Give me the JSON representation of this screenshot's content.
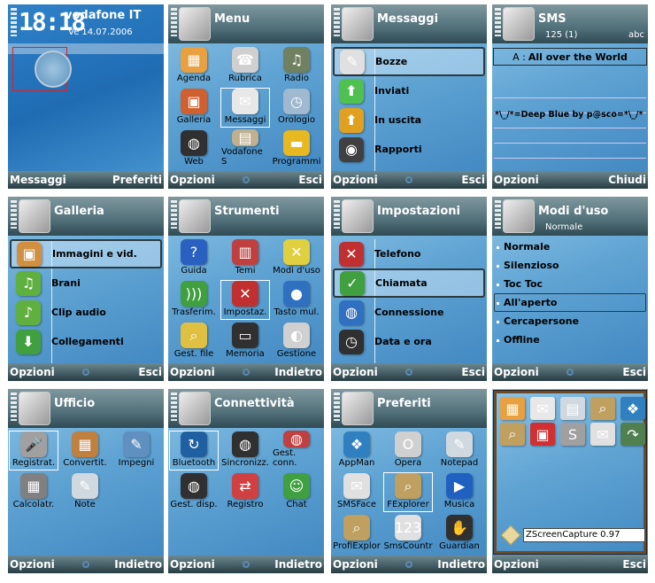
{
  "colors": {
    "highlight_border": "#2c3a40",
    "clock_frame": "#e02020",
    "bg_blue": "#5fa3d3"
  },
  "panels": [
    {
      "type": "home",
      "time": "18:18",
      "operator": "vodafone IT",
      "date": "Ve 14.07.2006",
      "soft_left": "Messaggi",
      "soft_right": "Preferiti"
    },
    {
      "type": "grid",
      "title": "Menu",
      "app_icon": "menu-icon",
      "selected": 4,
      "soft_left": "Opzioni",
      "soft_right": "Esci",
      "items": [
        {
          "label": "Agenda",
          "icon": "calendar",
          "color": "#e8a040",
          "glyph": "▦"
        },
        {
          "label": "Rubrica",
          "icon": "contacts",
          "color": "#d0d0d0",
          "glyph": "☎"
        },
        {
          "label": "Radio",
          "icon": "radio",
          "color": "#708060",
          "glyph": "♫"
        },
        {
          "label": "Galleria",
          "icon": "gallery",
          "color": "#d06030",
          "glyph": "▣"
        },
        {
          "label": "Messaggi",
          "icon": "envelope",
          "color": "#e8e8e8",
          "glyph": "✉"
        },
        {
          "label": "Orologio",
          "icon": "clock",
          "color": "#a0b8d0",
          "glyph": "◷"
        },
        {
          "label": "Web",
          "icon": "globe",
          "color": "#303030",
          "glyph": "◍"
        },
        {
          "label": "Vodafone S",
          "icon": "vodafone-services",
          "color": "#c0b090",
          "glyph": "▤"
        },
        {
          "label": "Programmi",
          "icon": "folder",
          "color": "#e8b820",
          "glyph": "▬"
        }
      ]
    },
    {
      "type": "list",
      "title": "Messaggi",
      "app_icon": "envelope-icon",
      "selected": 0,
      "soft_left": "Opzioni",
      "soft_right": "Esci",
      "items": [
        {
          "label": "Bozze",
          "icon": "drafts",
          "color": "#e0e0e0",
          "glyph": "✎"
        },
        {
          "label": "Inviati",
          "icon": "sent",
          "color": "#50c050",
          "glyph": "⬆"
        },
        {
          "label": "In uscita",
          "icon": "outbox",
          "color": "#e0a020",
          "glyph": "⬆"
        },
        {
          "label": "Rapporti",
          "icon": "reports",
          "color": "#404040",
          "glyph": "◉"
        }
      ]
    },
    {
      "type": "sms",
      "title": "SMS",
      "app_icon": "envelope-icon",
      "counter": "125 (1)",
      "mode": "abc",
      "to_label": "A :",
      "to_value": "All over the World",
      "body": "*\\_/*=Deep Blue by p@sco=*\\_/*",
      "soft_left": "Opzioni",
      "soft_right": "Chiudi"
    },
    {
      "type": "list",
      "title": "Galleria",
      "app_icon": "gallery-icon",
      "selected": 0,
      "soft_left": "Opzioni",
      "soft_right": "Esci",
      "items": [
        {
          "label": "Immagini e vid.",
          "icon": "images",
          "color": "#d09040",
          "glyph": "▣"
        },
        {
          "label": "Brani",
          "icon": "music",
          "color": "#60b040",
          "glyph": "♫"
        },
        {
          "label": "Clip audio",
          "icon": "audio-clip",
          "color": "#60b040",
          "glyph": "♪"
        },
        {
          "label": "Collegamenti",
          "icon": "links",
          "color": "#40a040",
          "glyph": "⬇"
        }
      ]
    },
    {
      "type": "grid",
      "title": "Strumenti",
      "app_icon": "menu-icon",
      "selected": 4,
      "soft_left": "Opzioni",
      "soft_right": "Indietro",
      "items": [
        {
          "label": "Guida",
          "icon": "help",
          "color": "#2a60c0",
          "glyph": "?"
        },
        {
          "label": "Temi",
          "icon": "themes",
          "color": "#c04040",
          "glyph": "▥"
        },
        {
          "label": "Modi d'uso",
          "icon": "profiles",
          "color": "#e0d040",
          "glyph": "✕"
        },
        {
          "label": "Trasferim.",
          "icon": "transfer",
          "color": "#40a040",
          "glyph": ")))"
        },
        {
          "label": "Impostaz.",
          "icon": "settings",
          "color": "#c03030",
          "glyph": "✕"
        },
        {
          "label": "Tasto mul.",
          "icon": "multimedia-key",
          "color": "#3070c0",
          "glyph": "●"
        },
        {
          "label": "Gest. file",
          "icon": "file-manager",
          "color": "#e0c040",
          "glyph": "⌕"
        },
        {
          "label": "Memoria",
          "icon": "memory",
          "color": "#303030",
          "glyph": "▭"
        },
        {
          "label": "Gestione",
          "icon": "app-manager",
          "color": "#d0d0d0",
          "glyph": "◐"
        }
      ]
    },
    {
      "type": "list",
      "title": "Impostazioni",
      "app_icon": "settings-icon",
      "selected": 1,
      "soft_left": "Opzioni",
      "soft_right": "Esci",
      "items": [
        {
          "label": "Telefono",
          "icon": "phone-settings",
          "color": "#c03030",
          "glyph": "✕"
        },
        {
          "label": "Chiamata",
          "icon": "call-settings",
          "color": "#40a040",
          "glyph": "✓"
        },
        {
          "label": "Connessione",
          "icon": "connection-settings",
          "color": "#3070c0",
          "glyph": "◍"
        },
        {
          "label": "Data e ora",
          "icon": "date-time",
          "color": "#303030",
          "glyph": "◷"
        }
      ]
    },
    {
      "type": "plain",
      "title": "Modi d'uso",
      "subtitle": "Normale",
      "app_icon": "profiles-icon",
      "selected": 3,
      "soft_left": "Opzioni",
      "soft_right": "Esci",
      "items": [
        "Normale",
        "Silenzioso",
        "Toc Toc",
        "All'aperto",
        "Cercapersone",
        "Offline"
      ]
    },
    {
      "type": "grid",
      "title": "Ufficio",
      "app_icon": "menu-icon",
      "selected": 0,
      "soft_left": "Opzioni",
      "soft_right": "Indietro",
      "items": [
        {
          "label": "Registrat.",
          "icon": "recorder",
          "color": "#a0a0a0",
          "glyph": "🎤"
        },
        {
          "label": "Convertit.",
          "icon": "converter",
          "color": "#c08040",
          "glyph": "▦"
        },
        {
          "label": "Impegni",
          "icon": "tasks",
          "color": "#6090c0",
          "glyph": "✎"
        },
        {
          "label": "Calcolatr.",
          "icon": "calculator",
          "color": "#808080",
          "glyph": "▦"
        },
        {
          "label": "Note",
          "icon": "notes",
          "color": "#d0d8e0",
          "glyph": "✎"
        }
      ]
    },
    {
      "type": "grid",
      "title": "Connettività",
      "app_icon": "menu-icon",
      "selected": 0,
      "soft_left": "Opzioni",
      "soft_right": "Indietro",
      "items": [
        {
          "label": "Bluetooth",
          "icon": "bluetooth",
          "color": "#2060a0",
          "glyph": "↻"
        },
        {
          "label": "Sincronizz.",
          "icon": "sync",
          "color": "#303030",
          "glyph": "◍"
        },
        {
          "label": "Gest. conn.",
          "icon": "connection-manager",
          "color": "#c04040",
          "glyph": "◍"
        },
        {
          "label": "Gest. disp.",
          "icon": "device-manager",
          "color": "#303030",
          "glyph": "◍"
        },
        {
          "label": "Registro",
          "icon": "log",
          "color": "#d04040",
          "glyph": "⇄"
        },
        {
          "label": "Chat",
          "icon": "chat",
          "color": "#40a040",
          "glyph": "☺"
        }
      ]
    },
    {
      "type": "grid",
      "title": "Preferiti",
      "app_icon": "menu-icon",
      "selected": 4,
      "soft_left": "Opzioni",
      "soft_right": "Indietro",
      "items": [
        {
          "label": "AppMan",
          "icon": "appman",
          "color": "#3080c0",
          "glyph": "❖"
        },
        {
          "label": "Opera",
          "icon": "opera",
          "color": "#d0d0d0",
          "glyph": "O"
        },
        {
          "label": "Notepad",
          "icon": "notepad",
          "color": "#d0d8e0",
          "glyph": "✎"
        },
        {
          "label": "SMSFace",
          "icon": "smsface",
          "color": "#e0e0e0",
          "glyph": "✉"
        },
        {
          "label": "FExplorer",
          "icon": "fexplorer",
          "color": "#c0a060",
          "glyph": "⌕"
        },
        {
          "label": "Musica",
          "icon": "music-player",
          "color": "#2060c0",
          "glyph": "▶"
        },
        {
          "label": "ProfiExplor",
          "icon": "profiexplorer",
          "color": "#c0a060",
          "glyph": "⌕"
        },
        {
          "label": "SmsCountr",
          "icon": "smscounter",
          "color": "#e0e0e0",
          "glyph": "123"
        },
        {
          "label": "Guardian",
          "icon": "guardian",
          "color": "#303030",
          "glyph": "✋"
        }
      ]
    },
    {
      "type": "zscreen",
      "soft_left": "Opzioni",
      "soft_right": "Esci",
      "input_value": "ZScreenCapture 0.97",
      "items": [
        {
          "icon": "calendar",
          "color": "#e8a040",
          "glyph": "▦"
        },
        {
          "icon": "envelope",
          "color": "#e8e8e8",
          "glyph": "✉"
        },
        {
          "icon": "notes",
          "color": "#d0d8e0",
          "glyph": "▤"
        },
        {
          "icon": "fexplorer",
          "color": "#c0a060",
          "glyph": "⌕"
        },
        {
          "icon": "appman",
          "color": "#3080c0",
          "glyph": "❖"
        },
        {
          "icon": "profiexplorer",
          "color": "#c0a060",
          "glyph": "⌕"
        },
        {
          "icon": "gift",
          "color": "#d03030",
          "glyph": "▣"
        },
        {
          "icon": "smsface",
          "color": "#a0a0a0",
          "glyph": "S"
        },
        {
          "icon": "mailbox",
          "color": "#e0e0e0",
          "glyph": "✉"
        },
        {
          "icon": "screen-capture",
          "color": "#508050",
          "glyph": "↷"
        }
      ]
    }
  ]
}
